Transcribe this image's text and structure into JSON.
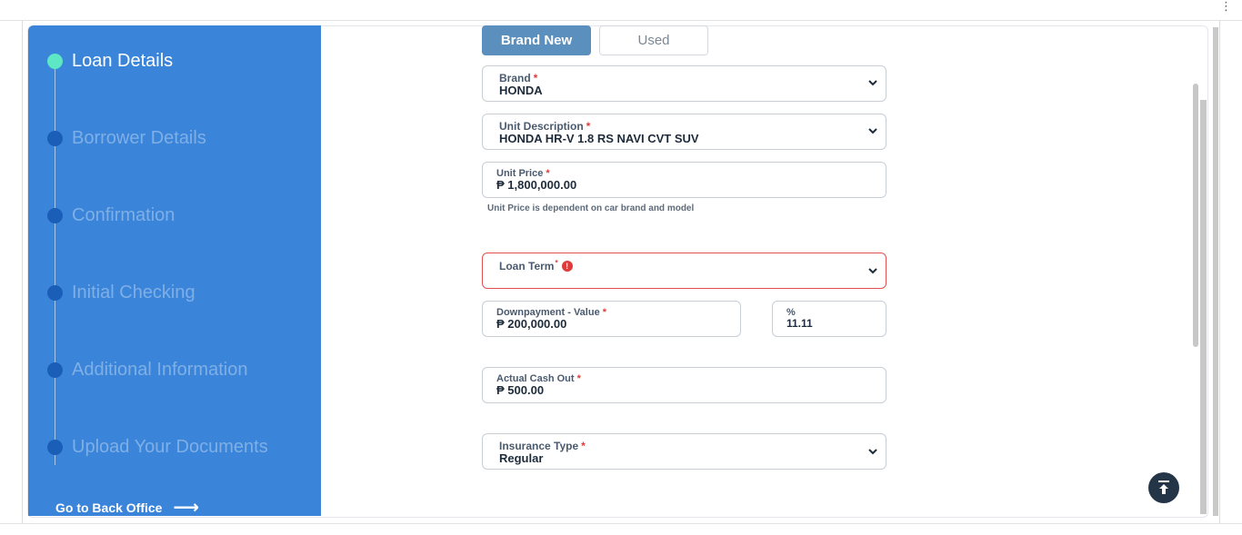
{
  "browser": {
    "menu_icon": "kebab-menu-icon"
  },
  "sidebar": {
    "steps": [
      {
        "label": "Loan Details",
        "active": true
      },
      {
        "label": "Borrower Details",
        "active": false
      },
      {
        "label": "Confirmation",
        "active": false
      },
      {
        "label": "Initial Checking",
        "active": false
      },
      {
        "label": "Additional Information",
        "active": false
      },
      {
        "label": "Upload Your Documents",
        "active": false
      }
    ],
    "back_office_label": "Go to Back Office",
    "back_office_icon": "arrow-right-icon"
  },
  "form": {
    "condition_toggle": {
      "brand_new": "Brand New",
      "used": "Used",
      "selected": "Brand New"
    },
    "brand": {
      "label": "Brand",
      "value": "HONDA"
    },
    "unit_description": {
      "label": "Unit Description",
      "value": "HONDA HR-V 1.8 RS NAVI CVT SUV"
    },
    "unit_price": {
      "label": "Unit Price",
      "value": "₱ 1,800,000.00",
      "helper": "Unit Price is dependent on car brand and model"
    },
    "loan_term": {
      "label": "Loan Term",
      "value": "",
      "error": true
    },
    "downpayment_value": {
      "label": "Downpayment - Value",
      "value": "₱ 200,000.00"
    },
    "downpayment_percent": {
      "label": "%",
      "value": "11.11"
    },
    "actual_cash_out": {
      "label": "Actual Cash Out",
      "value": "₱ 500.00"
    },
    "insurance_type": {
      "label": "Insurance Type",
      "value": "Regular"
    },
    "required_mark": "*"
  },
  "scroll_top_icon": "scroll-to-top-icon",
  "colors": {
    "sidebar_bg": "#3a84d9",
    "active_dot": "#5ee7c4",
    "inactive_dot": "#1a5eb8",
    "toggle_selected": "#5b8fbd",
    "error": "#e35151",
    "scroll_top_bg": "#243548"
  }
}
